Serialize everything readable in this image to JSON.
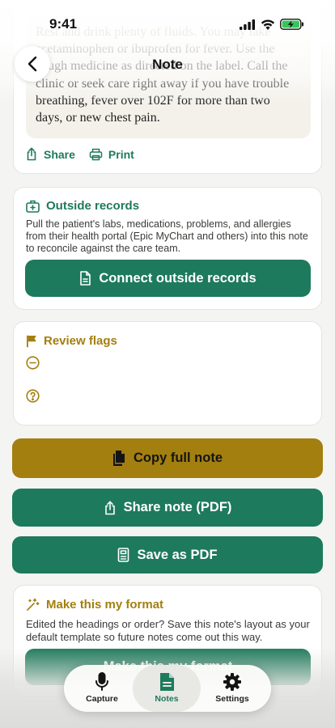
{
  "status_bar": {
    "time": "9:41"
  },
  "header": {
    "title": "Note"
  },
  "note_preview": {
    "lines": [
      "Rest and drink plenty of fluids. You may take",
      "acetaminophen or ibuprofen for fever. Use the",
      "cough medicine as directed on the label. Call the",
      "clinic or seek care right away if you have trouble",
      "breathing, fever over 102F for more than two",
      "days, or new chest pain."
    ],
    "share_label": "Share",
    "print_label": "Print"
  },
  "outside_records": {
    "title": "Outside records",
    "description": "Pull the patient's labs, medications, problems, and allergies from their health portal (Epic MyChart and others) into this note to reconcile against the care team.",
    "button_label": "Connect outside records"
  },
  "review_flags": {
    "title": "Review flags",
    "items": [
      {
        "icon": "minus-circle-icon",
        "text": ""
      },
      {
        "icon": "question-circle-icon",
        "text": ""
      }
    ]
  },
  "actions": {
    "copy_label": "Copy full note",
    "share_pdf_label": "Share note (PDF)",
    "save_pdf_label": "Save as PDF"
  },
  "format_card": {
    "title": "Make this my format",
    "description": "Edited the headings or order? Save this note's layout as your default template so future notes come out this way.",
    "button_label": "Make this my format"
  },
  "tab_bar": {
    "tabs": [
      {
        "label": "Capture",
        "icon": "microphone-icon",
        "active": false
      },
      {
        "label": "Notes",
        "icon": "document-icon",
        "active": true
      },
      {
        "label": "Settings",
        "icon": "gear-icon",
        "active": false
      }
    ]
  },
  "colors": {
    "green": "#1e7a5c",
    "gold": "#a37f0f",
    "background": "#f4f4f2"
  }
}
